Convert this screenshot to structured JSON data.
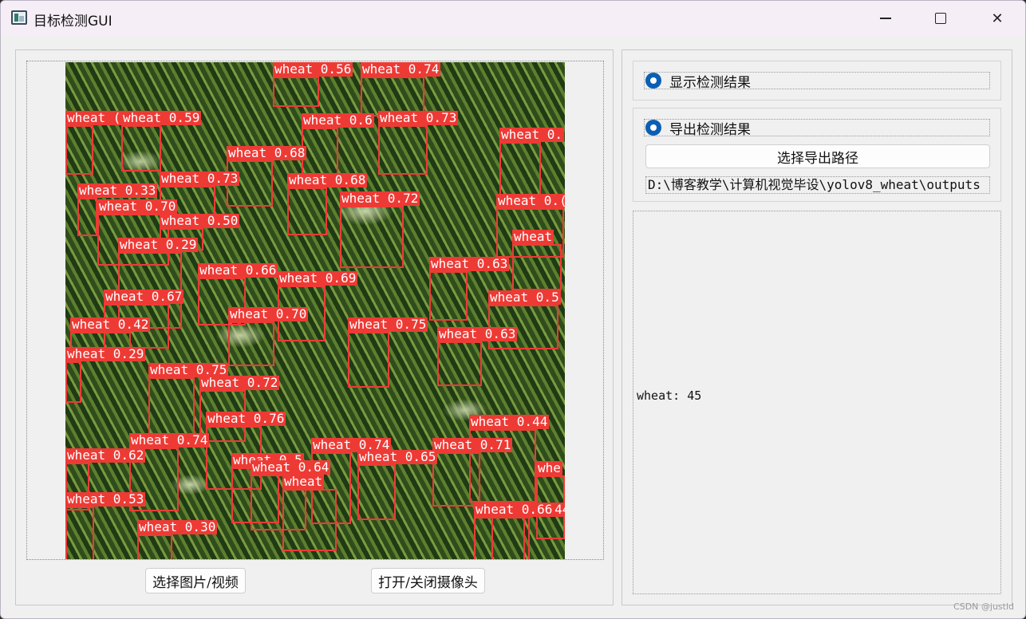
{
  "window": {
    "title": "目标检测GUI",
    "watermark": "CSDN @justld"
  },
  "left_panel": {
    "detections": [
      {
        "label": "wheat 0.56"
      },
      {
        "label": "wheat 0.74"
      },
      {
        "label": "wheat ("
      },
      {
        "label": "wheat 0.59"
      },
      {
        "label": "wheat 0.6"
      },
      {
        "label": "wheat 0.73"
      },
      {
        "label": "wheat 0."
      },
      {
        "label": "wheat 0.68"
      },
      {
        "label": "wheat 0.73"
      },
      {
        "label": "wheat 0.68"
      },
      {
        "label": "wheat 0.33"
      },
      {
        "label": "wheat 0.70"
      },
      {
        "label": "wheat 0.72"
      },
      {
        "label": "wheat 0.("
      },
      {
        "label": "wheat 0.50"
      },
      {
        "label": "wheat 0.29"
      },
      {
        "label": "wheat"
      },
      {
        "label": "wheat 0.66"
      },
      {
        "label": "wheat 0.63"
      },
      {
        "label": "wheat 0.69"
      },
      {
        "label": "wheat 0.67"
      },
      {
        "label": "wheat 0.5"
      },
      {
        "label": "wheat 0.70"
      },
      {
        "label": "wheat 0.42"
      },
      {
        "label": "wheat 0.75"
      },
      {
        "label": "wheat 0.63"
      },
      {
        "label": "wheat 0.29"
      },
      {
        "label": "wheat 0.75"
      },
      {
        "label": "wheat 0.72"
      },
      {
        "label": "wheat 0.76"
      },
      {
        "label": "wheat 0.44"
      },
      {
        "label": "wheat 0.74"
      },
      {
        "label": "wheat 0.74"
      },
      {
        "label": "wheat 0.71"
      },
      {
        "label": "wheat 0.62"
      },
      {
        "label": "wheat 0.65"
      },
      {
        "label": "wheat 0.5"
      },
      {
        "label": "wheat 0.64"
      },
      {
        "label": "wheat"
      },
      {
        "label": "whe"
      },
      {
        "label": "wheat 0.53"
      },
      {
        "label": "wheat 0.44"
      },
      {
        "label": "wheat 0.66"
      },
      {
        "label": "wheat 0.30"
      }
    ],
    "select_file_button": "选择图片/视频",
    "camera_button": "打开/关闭摄像头"
  },
  "right_panel": {
    "show_results_label": "显示检测结果",
    "export_results_label": "导出检测结果",
    "select_export_path_button": "选择导出路径",
    "export_path": "D:\\博客教学\\计算机视觉毕设\\yolov8_wheat\\outputs",
    "result_text": "wheat: 45"
  }
}
